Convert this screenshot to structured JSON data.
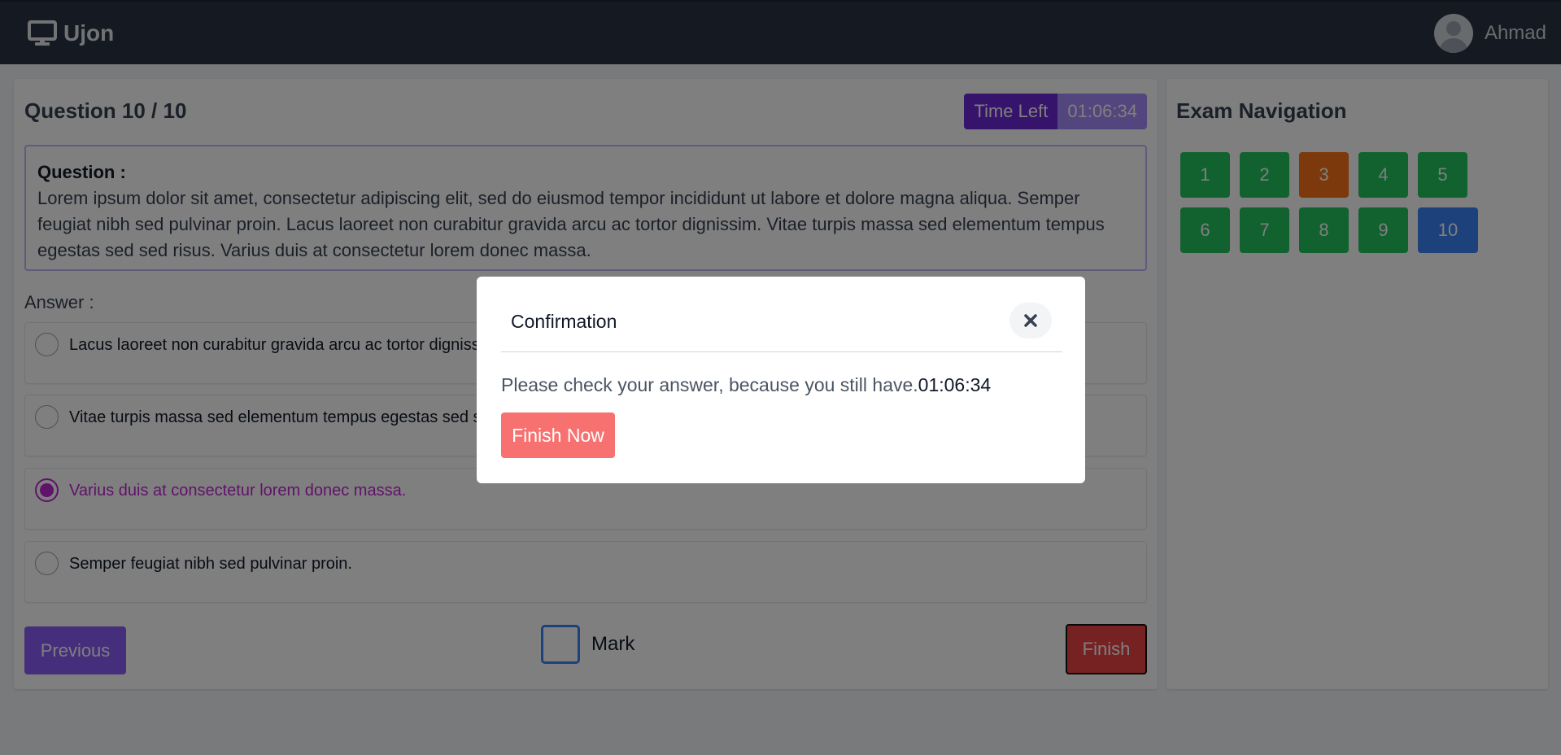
{
  "header": {
    "app_name": "Ujon",
    "user_name": "Ahmad",
    "brand_icon": "monitor-icon"
  },
  "question": {
    "counter": "Question 10 / 10",
    "time_left_label": "Time Left",
    "time_left_value": "01:06:34",
    "label": "Question :",
    "text": "Lorem ipsum dolor sit amet, consectetur adipiscing elit, sed do eiusmod tempor incididunt ut labore et dolore magna aliqua. Semper feugiat nibh sed pulvinar proin. Lacus laoreet non curabitur gravida arcu ac tortor dignissim. Vitae turpis massa sed elementum tempus egestas sed sed risus. Varius duis at consectetur lorem donec massa."
  },
  "answer": {
    "label": "Answer :",
    "options": [
      {
        "text": "Lacus laoreet non curabitur gravida arcu ac tortor dignissim.",
        "selected": false
      },
      {
        "text": "Vitae turpis massa sed elementum tempus egestas sed sed risus.",
        "selected": false
      },
      {
        "text": "Varius duis at consectetur lorem donec massa.",
        "selected": true
      },
      {
        "text": "Semper feugiat nibh sed pulvinar proin.",
        "selected": false
      }
    ]
  },
  "controls": {
    "previous_label": "Previous",
    "mark_label": "Mark",
    "finish_label": "Finish"
  },
  "navigation": {
    "title": "Exam Navigation",
    "items": [
      {
        "label": "1",
        "state": "answered"
      },
      {
        "label": "2",
        "state": "answered"
      },
      {
        "label": "3",
        "state": "marked"
      },
      {
        "label": "4",
        "state": "answered"
      },
      {
        "label": "5",
        "state": "answered"
      },
      {
        "label": "6",
        "state": "answered"
      },
      {
        "label": "7",
        "state": "answered"
      },
      {
        "label": "8",
        "state": "answered"
      },
      {
        "label": "9",
        "state": "answered"
      },
      {
        "label": "10",
        "state": "current"
      }
    ]
  },
  "modal": {
    "title": "Confirmation",
    "message": "Please check your answer, because you still have.",
    "time": "01:06:34",
    "finish_now_label": "Finish Now"
  },
  "colors": {
    "header_bg": "#2b3345",
    "timer_label_bg": "#6d28d9",
    "timer_value_bg": "#a78bfa",
    "answered": "#22c55e",
    "marked": "#f97316",
    "current": "#3b82f6",
    "finish": "#ef4444",
    "finish_now": "#f87171",
    "previous": "#8b5cf6",
    "selected_option": "#c026d3"
  }
}
